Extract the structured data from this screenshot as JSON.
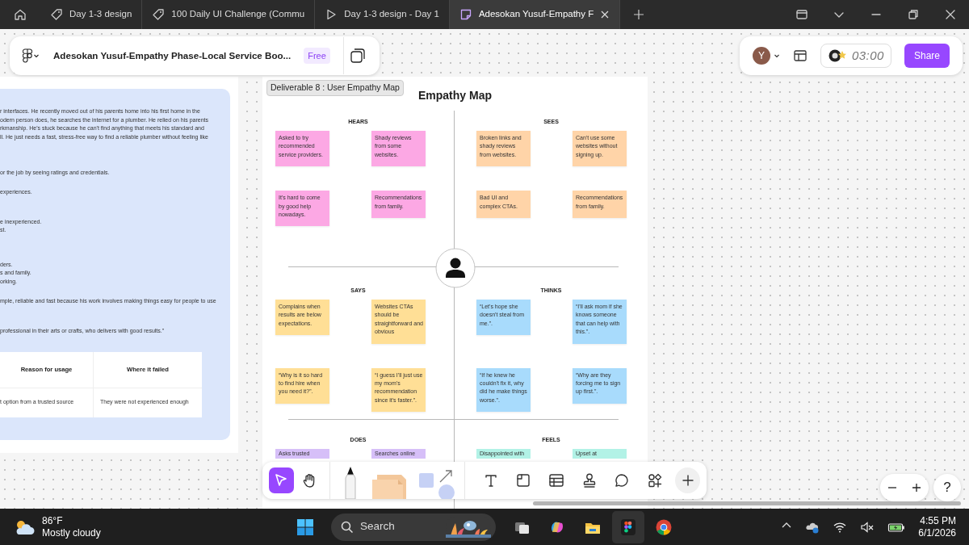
{
  "browser": {
    "tabs": [
      {
        "label": "Day 1-3 design",
        "kind": "board",
        "selected": false
      },
      {
        "label": "100 Daily UI Challenge (Commu",
        "kind": "board",
        "selected": false
      },
      {
        "label": "Day 1-3 design - Day 1",
        "kind": "slides",
        "selected": false
      },
      {
        "label": "Adesokan Yusuf-Empathy F",
        "kind": "whiteboard",
        "selected": true
      }
    ]
  },
  "file_bar": {
    "title": "Adesokan Yusuf-Empathy Phase-Local Service Boo...",
    "plan": "Free"
  },
  "session_bar": {
    "avatar": "Y",
    "timer": "03:00",
    "share": "Share"
  },
  "persona_doc": {
    "paragraphs": [
      [
        "r interfaces. He recently moved out of his parents home into his first home in the",
        "odern person does, he searches the internet for a plumber. He relied on his parents",
        "rkmanship. He's stuck because he can't find anything that meets his standard and",
        "ll. He just needs a fast, stress-free way to find a reliable plumber without feeling like"
      ],
      [
        "or the job by seeing ratings and credentials."
      ],
      [
        "experiences."
      ],
      [
        "e inexperienced.",
        "st."
      ],
      [
        "ders.",
        "s and family.",
        "orking."
      ],
      [
        "mple, reliable and fast because his work involves making things easy for people to use"
      ],
      [
        "professional in their arts or crafts, who delivers with good results.”"
      ]
    ],
    "table": {
      "columns": [
        "Reason for usage",
        "Where it failed"
      ],
      "rows": [
        [
          "t option from a trusted source",
          "They were not experienced enough"
        ]
      ]
    }
  },
  "empathy_map": {
    "tag": "Deliverable 8 : User Empathy Map",
    "title": "Empathy Map",
    "quadrants": [
      {
        "label": "HEARS",
        "color": "#fca8e4",
        "notes": [
          "Asked to try recommended service providers.",
          "Shady reviews from some websites.",
          "It's hard to come by good help nowadays.",
          "Recommendations from family."
        ]
      },
      {
        "label": "SEES",
        "color": "#ffd4a8",
        "notes": [
          "Broken links and shady reviews from websites.",
          "Can't use some websites without signing up.",
          "Bad UI and complex CTAs.",
          "Recommendations from family."
        ]
      },
      {
        "label": "SAYS",
        "color": "#ffdf96",
        "notes": [
          "Complains when results are below expectations.",
          "Websites CTAs should be straightforward and obvious",
          "“Why is it so hard to find hire when you need it?”.",
          "“I guess I'll just use my mom's recommendation since it's faster.”."
        ]
      },
      {
        "label": "THINKS",
        "color": "#a8dbfc",
        "notes": [
          "“Let's hope she doesn't steal from me.”.",
          "“I'll ask mom if she knows someone that can help with this.”.",
          "“If he knew he couldn't fix it, why did he make things worse.”.",
          "“Why are they forcing me to sign up first.”."
        ]
      },
      {
        "label": "DOES",
        "color": "#d6bff8",
        "notes": [
          "Asks trusted",
          "Searches online"
        ]
      },
      {
        "label": "FEELS",
        "color": "#b2f2e6",
        "notes": [
          "Disappointed with",
          "Upset at"
        ]
      }
    ]
  },
  "toolbar": {
    "tools": [
      {
        "kind": "select",
        "selected": true
      },
      {
        "kind": "hand",
        "selected": false
      },
      {
        "kind": "marker",
        "selected": false
      },
      {
        "kind": "sticky",
        "selected": false
      },
      {
        "kind": "shapes",
        "selected": false
      },
      {
        "kind": "text",
        "selected": false
      },
      {
        "kind": "section",
        "selected": false
      },
      {
        "kind": "table",
        "selected": false
      },
      {
        "kind": "stamp",
        "selected": false
      },
      {
        "kind": "comment",
        "selected": false
      },
      {
        "kind": "more",
        "selected": false
      },
      {
        "kind": "plus",
        "selected": false
      }
    ]
  },
  "zoom": {
    "help": "?"
  },
  "taskbar": {
    "temperature": "86°F",
    "condition": "Mostly cloudy",
    "search": "Search",
    "time": "4:55 PM",
    "date": "6/1/2026"
  }
}
